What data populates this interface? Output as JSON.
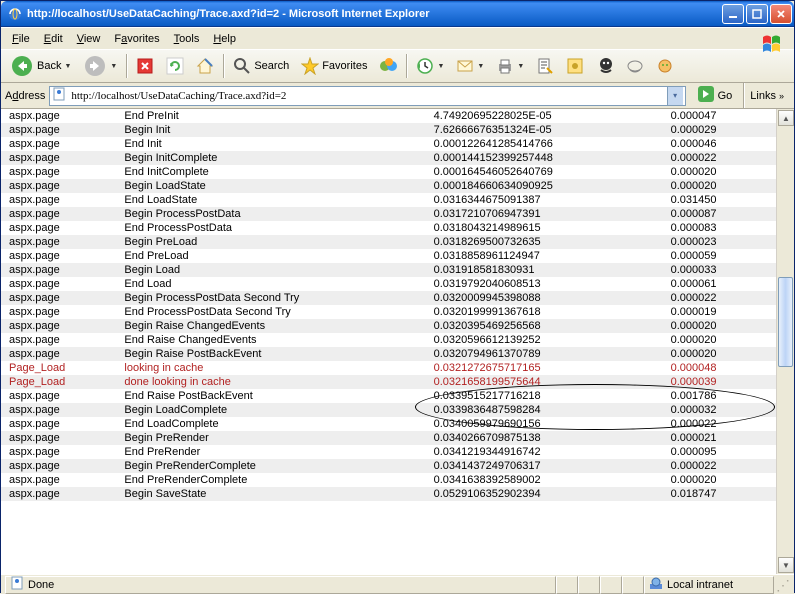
{
  "window": {
    "title": "http://localhost/UseDataCaching/Trace.axd?id=2 - Microsoft Internet Explorer"
  },
  "menubar": {
    "items": [
      {
        "label": "File",
        "key": "F"
      },
      {
        "label": "Edit",
        "key": "E"
      },
      {
        "label": "View",
        "key": "V"
      },
      {
        "label": "Favorites",
        "key": "a"
      },
      {
        "label": "Tools",
        "key": "T"
      },
      {
        "label": "Help",
        "key": "H"
      }
    ]
  },
  "toolbar": {
    "back": "Back",
    "search": "Search",
    "favorites": "Favorites"
  },
  "addressbar": {
    "label": "Address",
    "key": "d",
    "url": "http://localhost/UseDataCaching/Trace.axd?id=2",
    "go": "Go",
    "links": "Links"
  },
  "trace": {
    "rows": [
      {
        "cat": "aspx.page",
        "msg": "End PreInit",
        "t1": "4.74920695228025E-05",
        "t2": "0.000047",
        "hi": false
      },
      {
        "cat": "aspx.page",
        "msg": "Begin Init",
        "t1": "7.62666676351324E-05",
        "t2": "0.000029",
        "hi": false
      },
      {
        "cat": "aspx.page",
        "msg": "End Init",
        "t1": "0.000122641285414766",
        "t2": "0.000046",
        "hi": false
      },
      {
        "cat": "aspx.page",
        "msg": "Begin InitComplete",
        "t1": "0.000144152399257448",
        "t2": "0.000022",
        "hi": false
      },
      {
        "cat": "aspx.page",
        "msg": "End InitComplete",
        "t1": "0.000164546052640769",
        "t2": "0.000020",
        "hi": false
      },
      {
        "cat": "aspx.page",
        "msg": "Begin LoadState",
        "t1": "0.000184660634090925",
        "t2": "0.000020",
        "hi": false
      },
      {
        "cat": "aspx.page",
        "msg": "End LoadState",
        "t1": "0.0316344675091387",
        "t2": "0.031450",
        "hi": false
      },
      {
        "cat": "aspx.page",
        "msg": "Begin ProcessPostData",
        "t1": "0.0317210706947391",
        "t2": "0.000087",
        "hi": false
      },
      {
        "cat": "aspx.page",
        "msg": "End ProcessPostData",
        "t1": "0.0318043214989615",
        "t2": "0.000083",
        "hi": false
      },
      {
        "cat": "aspx.page",
        "msg": "Begin PreLoad",
        "t1": "0.0318269500732635",
        "t2": "0.000023",
        "hi": false
      },
      {
        "cat": "aspx.page",
        "msg": "End PreLoad",
        "t1": "0.0318858961124947",
        "t2": "0.000059",
        "hi": false
      },
      {
        "cat": "aspx.page",
        "msg": "Begin Load",
        "t1": "0.031918581830931",
        "t2": "0.000033",
        "hi": false
      },
      {
        "cat": "aspx.page",
        "msg": "End Load",
        "t1": "0.0319792040608513",
        "t2": "0.000061",
        "hi": false
      },
      {
        "cat": "aspx.page",
        "msg": "Begin ProcessPostData Second Try",
        "t1": "0.0320009945398088",
        "t2": "0.000022",
        "hi": false
      },
      {
        "cat": "aspx.page",
        "msg": "End ProcessPostData Second Try",
        "t1": "0.0320199991367618",
        "t2": "0.000019",
        "hi": false
      },
      {
        "cat": "aspx.page",
        "msg": "Begin Raise ChangedEvents",
        "t1": "0.0320395469256568",
        "t2": "0.000020",
        "hi": false
      },
      {
        "cat": "aspx.page",
        "msg": "End Raise ChangedEvents",
        "t1": "0.0320596612139252",
        "t2": "0.000020",
        "hi": false
      },
      {
        "cat": "aspx.page",
        "msg": "Begin Raise PostBackEvent",
        "t1": "0.0320794961370789",
        "t2": "0.000020",
        "hi": false
      },
      {
        "cat": "Page_Load",
        "msg": "looking in cache",
        "t1": "0.0321272675717165",
        "t2": "0.000048",
        "hi": true
      },
      {
        "cat": "Page_Load",
        "msg": "done looking in cache",
        "t1": "0.0321658199575644",
        "t2": "0.000039",
        "hi": true
      },
      {
        "cat": "aspx.page",
        "msg": "End Raise PostBackEvent",
        "t1": "0.0339515217716218",
        "t2": "0.001786",
        "hi": false
      },
      {
        "cat": "aspx.page",
        "msg": "Begin LoadComplete",
        "t1": "0.0339836487598284",
        "t2": "0.000032",
        "hi": false
      },
      {
        "cat": "aspx.page",
        "msg": "End LoadComplete",
        "t1": "0.0340059979690156",
        "t2": "0.000022",
        "hi": false
      },
      {
        "cat": "aspx.page",
        "msg": "Begin PreRender",
        "t1": "0.0340266709875138",
        "t2": "0.000021",
        "hi": false
      },
      {
        "cat": "aspx.page",
        "msg": "End PreRender",
        "t1": "0.0341219344916742",
        "t2": "0.000095",
        "hi": false
      },
      {
        "cat": "aspx.page",
        "msg": "Begin PreRenderComplete",
        "t1": "0.0341437249706317",
        "t2": "0.000022",
        "hi": false
      },
      {
        "cat": "aspx.page",
        "msg": "End PreRenderComplete",
        "t1": "0.0341638392589002",
        "t2": "0.000020",
        "hi": false
      },
      {
        "cat": "aspx.page",
        "msg": "Begin SaveState",
        "t1": "0.0529106352902394",
        "t2": "0.018747",
        "hi": false
      }
    ]
  },
  "statusbar": {
    "status": "Done",
    "zone": "Local intranet"
  }
}
